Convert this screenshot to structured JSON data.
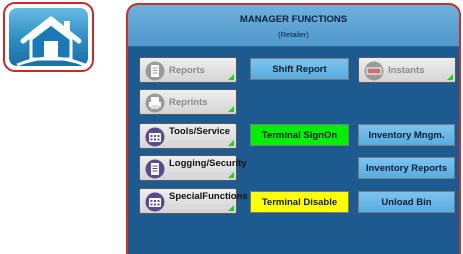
{
  "header": {
    "title": "MANAGER FUNCTIONS",
    "subtitle": "(Retailer)"
  },
  "buttons": {
    "reports": "Reports",
    "shift_report": "Shift Report",
    "instants": "Instants",
    "reprints": "Reprints",
    "tools_service_line1": "Tools/",
    "tools_service_line2": "Service",
    "terminal_signon": "Terminal SignOn",
    "inventory_mngm": "Inventory Mngm.",
    "logging_security_line1": "Logging/",
    "logging_security_line2": "Security",
    "inventory_reports": "Inventory Reports",
    "special_functions_line1": "Special",
    "special_functions_line2": "Functions",
    "terminal_disable": "Terminal Disable",
    "unload_bin": "Unload Bin"
  },
  "colors": {
    "panel": "#1d5a8f",
    "border": "#c8302e",
    "enabled_corner": "#28c828",
    "signon": "#00f000",
    "disable": "#ffff00"
  },
  "icons": {
    "home": "home-icon",
    "reports": "document-icon",
    "instants": "ticket-icon",
    "reprints": "printer-icon",
    "tools": "keypad-icon",
    "logging": "document-icon",
    "special": "keypad-icon"
  }
}
